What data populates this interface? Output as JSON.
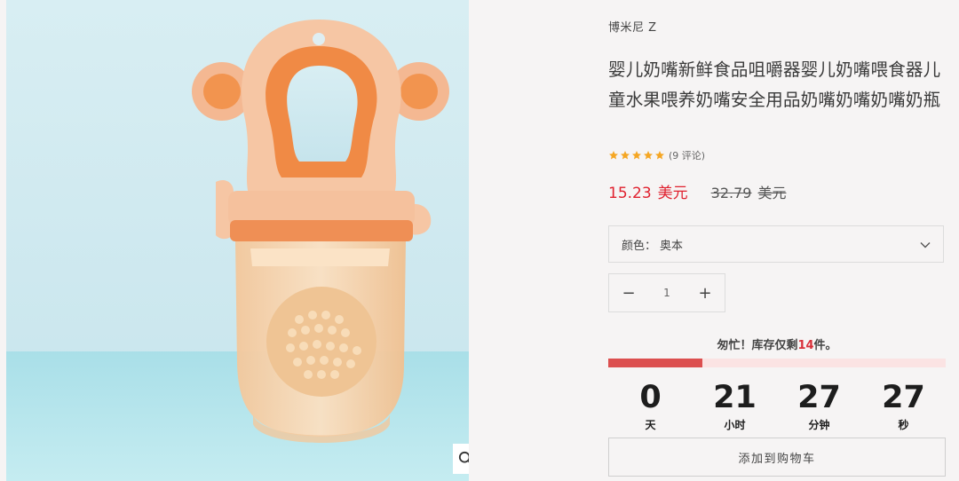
{
  "product": {
    "brand": "博米尼 Z",
    "title": "婴儿奶嘴新鲜食品咀嚼器婴儿奶嘴喂食器儿童水果喂养奶嘴安全用品奶嘴奶嘴奶嘴奶瓶",
    "rating": 5,
    "reviews_text": "(9 评论)",
    "price_sale": "15.23",
    "price_old": "32.79",
    "currency": "美元",
    "star_color": "#f5a623",
    "sale_color": "#e0202e"
  },
  "variant": {
    "label": "颜色：",
    "value": "奥本"
  },
  "quantity": {
    "minus": "−",
    "value": "1",
    "plus": "+"
  },
  "stock": {
    "prefix": "匆忙！库存仅剩",
    "count": "14",
    "suffix": "件。",
    "fill_fraction": 0.28
  },
  "countdown": [
    {
      "value": "0",
      "label": "天"
    },
    {
      "value": "21",
      "label": "小时"
    },
    {
      "value": "27",
      "label": "分钟"
    },
    {
      "value": "27",
      "label": "秒"
    }
  ],
  "cart": {
    "add_label": "添加到购物车"
  },
  "icons": {
    "zoom": "magnifier-icon",
    "dropdown": "chevron-down-icon",
    "star": "star-icon"
  }
}
